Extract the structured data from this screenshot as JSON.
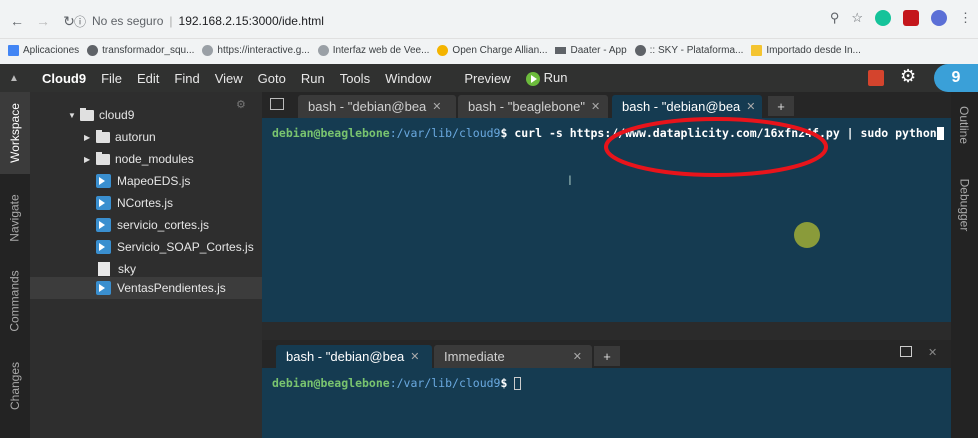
{
  "browser": {
    "security_text": "No es seguro",
    "url": "192.168.2.15:3000/ide.html",
    "bookmarks": [
      {
        "label": "Aplicaciones",
        "color": "#4285f4"
      },
      {
        "label": "transformador_squ...",
        "color": "#5f6368"
      },
      {
        "label": "https://interactive.g...",
        "color": "#5f6368"
      },
      {
        "label": "Interfaz web de Vee...",
        "color": "#5f6368"
      },
      {
        "label": "Open Charge Allian...",
        "color": "#f4b400"
      },
      {
        "label": "Daater - App",
        "color": "#5f6368"
      },
      {
        "label": ":: SKY - Plataforma...",
        "color": "#5f6368"
      },
      {
        "label": "Importado desde In...",
        "color": "#f4c430"
      }
    ]
  },
  "ide": {
    "brand": "Cloud9",
    "menu": [
      "File",
      "Edit",
      "Find",
      "View",
      "Goto",
      "Run",
      "Tools",
      "Window"
    ],
    "preview": "Preview",
    "run": "Run",
    "left_tabs": [
      "Workspace",
      "Navigate",
      "Commands",
      "Changes"
    ],
    "right_tabs": [
      "Outline",
      "Debugger"
    ],
    "tree": {
      "root": "cloud9",
      "folders": [
        "autorun",
        "node_modules"
      ],
      "files": [
        "MapeoEDS.js",
        "NCortes.js",
        "servicio_cortes.js",
        "Servicio_SOAP_Cortes.js",
        "sky",
        "VentasPendientes.js"
      ]
    },
    "top_tabs": [
      "bash - \"debian@bea",
      "bash - \"beaglebone\"",
      "bash - \"debian@bea"
    ],
    "top_terminal": {
      "user": "debian@beaglebone",
      "path": ":/var/lib/cloud9",
      "command": "$ curl -s https://www.dataplicity.com/16xfn24f.py | sudo python"
    },
    "bottom_tabs": [
      "bash - \"debian@bea",
      "Immediate"
    ],
    "bottom_terminal": {
      "user": "debian@beaglebone",
      "path": ":/var/lib/cloud9",
      "prompt": "$ "
    },
    "colors": {
      "terminal_bg": "#153b51",
      "annotation": "#e8141b"
    }
  }
}
